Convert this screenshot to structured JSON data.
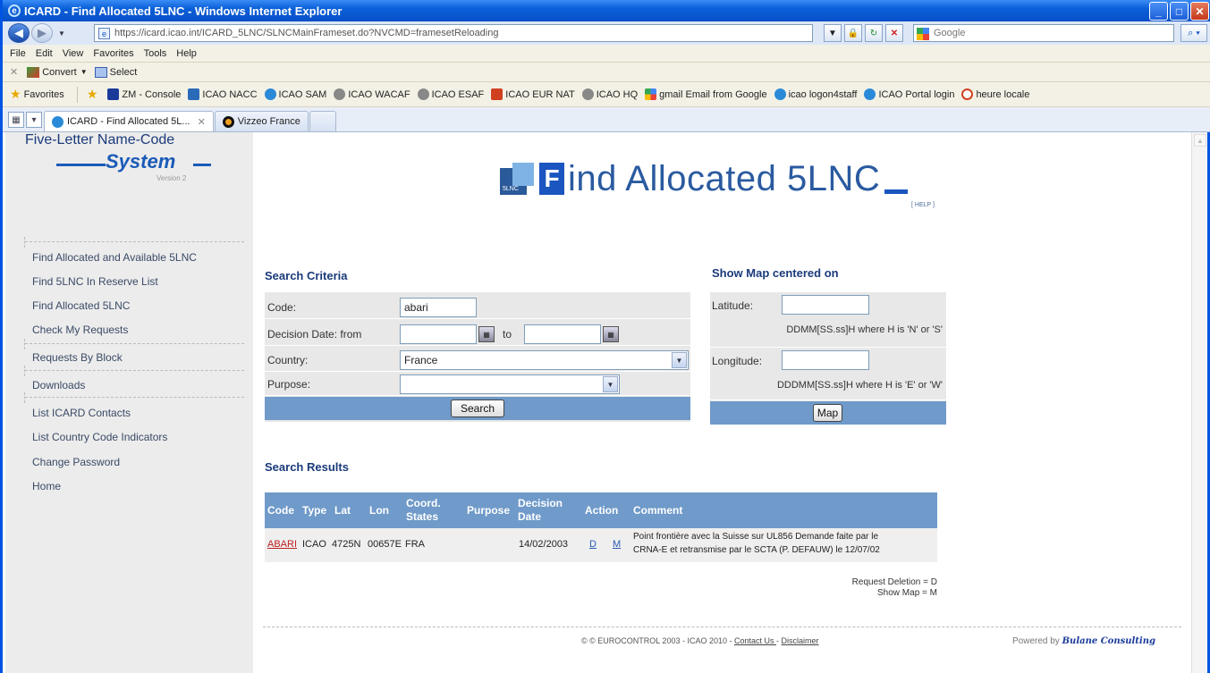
{
  "window": {
    "title": "ICARD - Find Allocated 5LNC - Windows Internet Explorer",
    "address": "https://icard.icao.int/ICARD_5LNC/SLNCMainFrameset.do?NVCMD=framesetReloading",
    "address_host": "icao.int",
    "search_placeholder": "Google"
  },
  "menu": [
    "File",
    "Edit",
    "View",
    "Favorites",
    "Tools",
    "Help"
  ],
  "commandbar": {
    "convert": "Convert",
    "select": "Select"
  },
  "favorites": {
    "label": "Favorites",
    "items": [
      {
        "label": "ZM - Console",
        "color": "#1a3a9a"
      },
      {
        "label": "ICAO NACC",
        "color": "#2a6ab8"
      },
      {
        "label": "ICAO SAM",
        "color": "#2a8ad8"
      },
      {
        "label": "ICAO WACAF",
        "color": "#888888"
      },
      {
        "label": "ICAO  ESAF",
        "color": "#888888"
      },
      {
        "label": "ICAO EUR NAT",
        "color": "#d04020"
      },
      {
        "label": "ICAO HQ",
        "color": "#888888"
      },
      {
        "label": "gmail Email from Google",
        "color": "#34a853"
      },
      {
        "label": "icao logon4staff",
        "color": "#2a8ad8"
      },
      {
        "label": "ICAO Portal login",
        "color": "#2a8ad8"
      },
      {
        "label": "heure locale",
        "color": "#d04020"
      }
    ]
  },
  "tabs": [
    {
      "label": "ICARD - Find Allocated 5L...",
      "active": true
    },
    {
      "label": "Vizzeo France",
      "active": false
    }
  ],
  "sidebar": {
    "logo_line1": "Five-Letter Name-Code",
    "logo_line2": "System",
    "logo_version": "Version 2",
    "items": [
      "Find Allocated and Available 5LNC",
      "Find 5LNC In Reserve List",
      "Find Allocated 5LNC",
      "Check My Requests",
      "Requests By Block",
      "Downloads",
      "List ICARD Contacts",
      "List Country Code Indicators",
      "Change Password",
      "Home"
    ]
  },
  "header": {
    "title": "ind Allocated 5LNC",
    "letter": "F",
    "tag": "5LNC",
    "help": "[ HELP ]"
  },
  "criteria": {
    "title": "Search Criteria",
    "code_label": "Code:",
    "code_value": "abari",
    "date_label": "Decision Date:  from",
    "date_to": "to",
    "country_label": "Country:",
    "country_value": "France",
    "purpose_label": "Purpose:",
    "purpose_value": "",
    "search_button": "Search"
  },
  "map": {
    "title": "Show Map centered on",
    "lat_label": "Latitude:",
    "lat_hint": "DDMM[SS.ss]H where H is 'N' or 'S'",
    "lon_label": "Longitude:",
    "lon_hint": "DDDMM[SS.ss]H where H is 'E' or 'W'",
    "map_button": "Map"
  },
  "results": {
    "title": "Search Results",
    "headers": {
      "code": "Code",
      "type": "Type",
      "lat": "Lat",
      "lon": "Lon",
      "coord1": "Coord.",
      "coord2": "States",
      "purpose": "Purpose",
      "date1": "Decision",
      "date2": "Date",
      "action": "Action",
      "comment": "Comment"
    },
    "row": {
      "code": "ABARI",
      "type": "ICAO",
      "lat": "4725N",
      "lon": "00657E",
      "coord": "FRA",
      "purpose": "",
      "date": "14/02/2003",
      "action_d": "D",
      "action_m": "M",
      "comment1": "Point frontière avec la Suisse sur UL856 Demande faite par le",
      "comment2": "CRNA-E et retransmise par le SCTA (P. DEFAUW) le 12/07/02"
    },
    "legend1": "Request Deletion = D",
    "legend2": "Show Map = M"
  },
  "footer": {
    "copyright": "© © EUROCONTROL 2003 - ICAO 2010 - ",
    "contact": "Contact Us ",
    "sep": "- ",
    "disclaimer": "Disclaimer",
    "powered": "Powered by ",
    "company": "Bulane Consulting"
  }
}
